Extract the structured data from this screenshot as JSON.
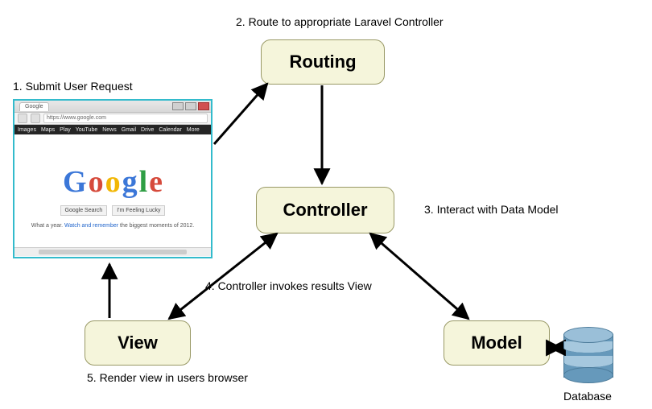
{
  "nodes": {
    "routing": "Routing",
    "controller": "Controller",
    "view": "View",
    "model": "Model",
    "database": "Database"
  },
  "labels": {
    "step1": "1. Submit User Request",
    "step2": "2. Route to appropriate Laravel Controller",
    "step3": "3. Interact with Data Model",
    "step4": "4. Controller invokes results View",
    "step5": "5. Render view in users browser"
  },
  "browser": {
    "tab": "Google",
    "url": "https://www.google.com",
    "menu": [
      "Images",
      "Maps",
      "Play",
      "YouTube",
      "News",
      "Gmail",
      "Drive",
      "Calendar",
      "More"
    ],
    "btn1": "Google Search",
    "btn2": "I'm Feeling Lucky",
    "footer_prefix": "What a year. ",
    "footer_link": "Watch and remember",
    "footer_suffix": " the biggest moments of 2012."
  }
}
